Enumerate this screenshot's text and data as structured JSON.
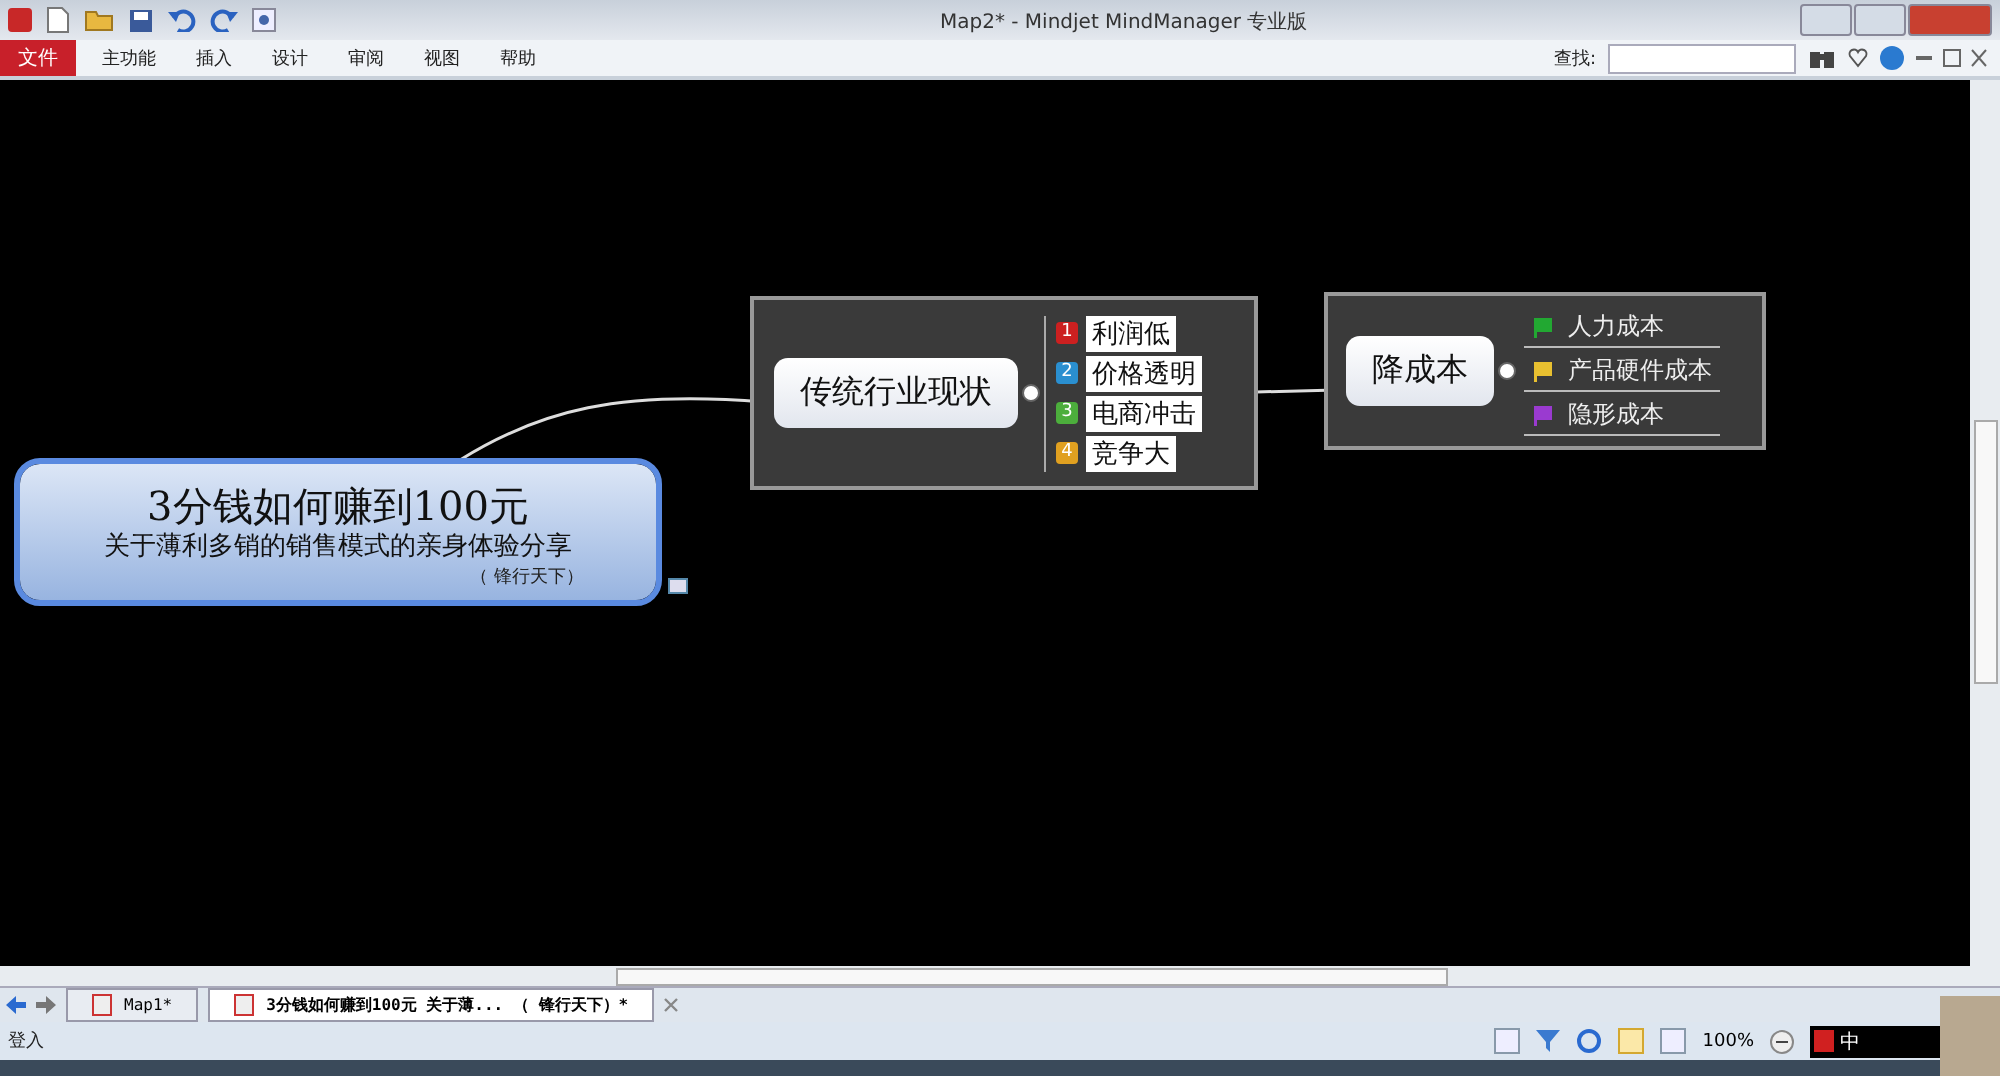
{
  "window": {
    "title": "Map2* - Mindjet MindManager 专业版"
  },
  "ribbon_tabs": [
    {
      "label": "文件",
      "kind": "file"
    },
    {
      "label": "主功能",
      "kind": "tab"
    },
    {
      "label": "插入",
      "kind": "tab"
    },
    {
      "label": "设计",
      "kind": "tab"
    },
    {
      "label": "审阅",
      "kind": "tab"
    },
    {
      "label": "视图",
      "kind": "tab"
    },
    {
      "label": "帮助",
      "kind": "tab"
    }
  ],
  "search": {
    "label": "查找:"
  },
  "map": {
    "central": {
      "title": "3分钱如何赚到100元",
      "subtitle": "关于薄利多销的销售模式的亲身体验分享",
      "author": "（ 锋行天下）",
      "selected": true
    },
    "topics": [
      {
        "label": "传统行业现状",
        "children": [
          {
            "label": "利润低",
            "marker": "1",
            "color": "#cc2020"
          },
          {
            "label": "价格透明",
            "marker": "2",
            "color": "#2a8fd0"
          },
          {
            "label": "电商冲击",
            "marker": "3",
            "color": "#4cae3c"
          },
          {
            "label": "竞争大",
            "marker": "4",
            "color": "#e0a020"
          }
        ]
      },
      {
        "label": "降成本",
        "children": [
          {
            "label": "人力成本",
            "color": "#22a832"
          },
          {
            "label": "产品硬件成本",
            "color": "#e8c030"
          },
          {
            "label": "隐形成本",
            "color": "#9a3ad0"
          }
        ]
      }
    ]
  },
  "doc_tabs": [
    {
      "label": "Map1*",
      "selected": false
    },
    {
      "label": "3分钱如何赚到100元 关于薄...      （ 锋行天下）*",
      "selected": true
    }
  ],
  "status_bar": {
    "login": "登入",
    "zoom": "100%"
  },
  "tray": {
    "ime": "中"
  }
}
